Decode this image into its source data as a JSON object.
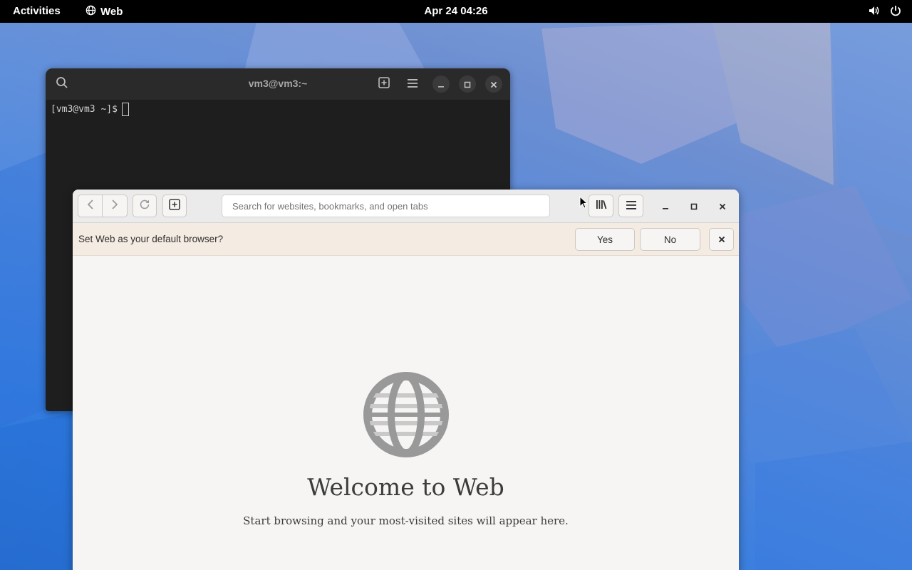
{
  "topbar": {
    "activities": "Activities",
    "app_name": "Web",
    "clock": "Apr 24  04:26",
    "icons": [
      "globe-icon",
      "volume-icon",
      "power-icon"
    ]
  },
  "terminal": {
    "title": "vm3@vm3:~",
    "prompt": "[vm3@vm3 ~]$",
    "icons": [
      "search-icon",
      "new-tab-icon",
      "menu-icon",
      "minimize-icon",
      "maximize-icon",
      "close-icon"
    ]
  },
  "browser": {
    "search_placeholder": "Search for websites, bookmarks, and open tabs",
    "icons": [
      "back-icon",
      "forward-icon",
      "reload-icon",
      "new-tab-icon",
      "library-icon",
      "menu-icon",
      "minimize-icon",
      "maximize-icon",
      "close-icon"
    ],
    "infobar": {
      "message": "Set Web as your default browser?",
      "yes_label": "Yes",
      "no_label": "No"
    },
    "welcome": {
      "title": "Welcome to Web",
      "subtitle": "Start browsing and your most-visited sites will appear here."
    }
  },
  "colors": {
    "topbar_bg": "#000000",
    "terminal_bg": "#1e1e1e",
    "browser_bg": "#f6f5f4",
    "infobar_bg": "#f4ebe2",
    "globe_gray": "#999999"
  }
}
